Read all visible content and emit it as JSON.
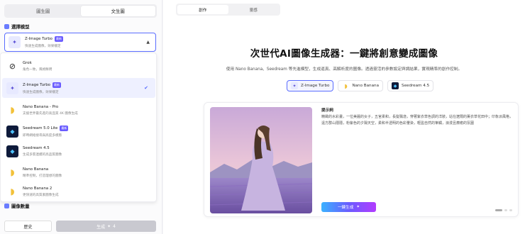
{
  "left": {
    "mode_tabs": [
      "圖生圖",
      "文生圖"
    ],
    "active_mode": 1,
    "model_section_title": "選擇模型",
    "selected": {
      "name": "Z-Image Turbo",
      "badge": "最新",
      "desc": "快速生成圖像，效果穩定"
    },
    "dropdown": [
      {
        "icon": "grok-icon",
        "name": "Grok",
        "badge": "",
        "desc": "角色一致，風格鮮明",
        "selected": false
      },
      {
        "icon": "z-image-icon",
        "name": "Z-Image Turbo",
        "badge": "最新",
        "desc": "快速生成圖像，效果穩定",
        "selected": true
      },
      {
        "icon": "banana-icon",
        "name": "Nano Banana - Pro",
        "badge": "",
        "desc": "支援世界最先進的高品質 4K 圖像生成",
        "selected": false
      },
      {
        "icon": "seedream-icon",
        "name": "Seedream 5.0 Lite",
        "badge": "最新",
        "desc": "即時網絡搜尋與高度多模態",
        "selected": false
      },
      {
        "icon": "seedream-icon",
        "name": "Seedream 4.5",
        "badge": "",
        "desc": "生成多張連續的高品質圖像",
        "selected": false
      },
      {
        "icon": "banana-icon",
        "name": "Nano Banana",
        "badge": "",
        "desc": "精準控制，打造理想的圖像",
        "selected": false
      },
      {
        "icon": "banana-icon",
        "name": "Nano Banana 2",
        "badge": "",
        "desc": "更快速的高質素圖像生成",
        "selected": false
      }
    ],
    "count_section_title": "圖像數量",
    "history_button": "歷史",
    "generate_button": "生成",
    "generate_cost": "4"
  },
  "right": {
    "view_tabs": [
      "創作",
      "靈感"
    ],
    "active_view": 0,
    "title": "次世代AI圖像生成器：一鍵將創意變成圖像",
    "subtitle": "使用 Nano Banana、Seedream 等先進模型，生成逼真、高解析度的圖像。透過靈活的參數設定與調結果，實現精準的創作控制。",
    "chips": [
      {
        "icon": "z-image-icon",
        "label": "Z-Image Turbo",
        "active": true
      },
      {
        "icon": "banana-icon",
        "label": "Nano Banana",
        "active": false
      },
      {
        "icon": "seedream-icon",
        "label": "Seedream 4.5",
        "active": false
      }
    ],
    "prompt_label": "提示詞",
    "prompt_text": "精緻的水彩畫，一位美麗的女子，五官柔和，長髮飄逸，穿著紫衣草色調的洋裝，站在遼闊的薰衣草花田中；印象派風格，遠方群山隱隱，粉紫色的夕陽天空，柔和半透明的色彩暈染，輕盈自然的筆觸，浪漫且療癒的氛圍",
    "card_generate_button": "一鍵生成",
    "pager": {
      "current": 1,
      "total": 3
    }
  },
  "colors": {
    "accent": "#5a6dff",
    "badge": "#6a5cff",
    "disabled": "#c9c9d0"
  }
}
